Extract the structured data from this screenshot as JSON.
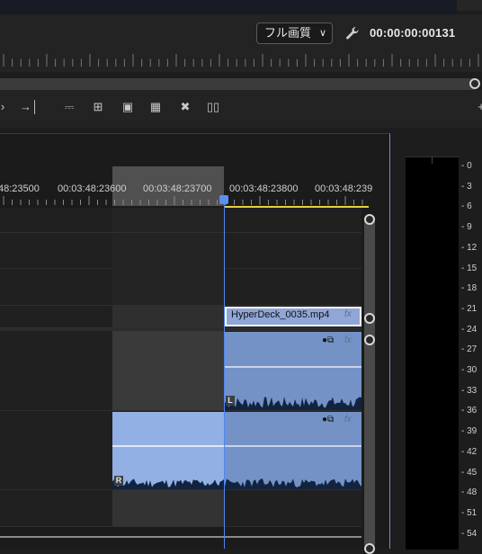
{
  "program_monitor": {
    "quality": "フル画質",
    "timecode": "00:00:00:00131"
  },
  "toolbar_icons": [
    "step-forward-icon",
    "insert-edit-icon",
    "lift-icon",
    "extract-icon",
    "camera-icon",
    "multi-cam-icon",
    "vr-icon",
    "comparison-icon",
    "add-button-icon"
  ],
  "timeline": {
    "ruler_labels": [
      "48:23500",
      "00:03:48:23600",
      "00:03:48:23700",
      "00:03:48:23800",
      "00:03:48:239"
    ],
    "video_clip": {
      "name": "HyperDeck_0035.mp4",
      "fx": "fx"
    },
    "audio_clips": [
      {
        "channel": "L",
        "fx": "fx"
      },
      {
        "channel": "R",
        "fx": "fx"
      }
    ]
  },
  "audio_meter": {
    "scale": [
      "0",
      "-3",
      "-6",
      "-9",
      "-12",
      "-15",
      "-18",
      "-21",
      "-24",
      "-27",
      "-30",
      "-33",
      "-36",
      "-39",
      "-42",
      "-45",
      "-48",
      "-51",
      "-54"
    ]
  },
  "colors": {
    "accent": "#4f86f0",
    "clip_video": "#8fa6d7",
    "clip_audio": "#7492c6",
    "in_out": "#e6d23c"
  }
}
